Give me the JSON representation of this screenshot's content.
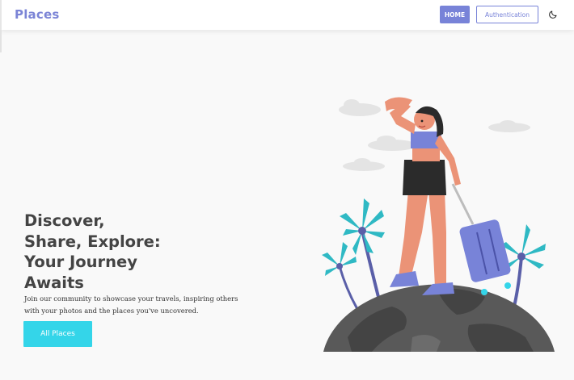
{
  "app": {
    "brand": "Places"
  },
  "nav": {
    "home_label": "HOME",
    "auth_label": "Authentication",
    "theme_icon": "moon-icon"
  },
  "hero": {
    "headline": "Discover,\nShare, Explore:\nYour Journey\nAwaits",
    "subtext": "Join our community to showcase your travels, inspiring others with your photos and the places you've uncovered.",
    "cta_label": "All Places"
  },
  "colors": {
    "brand": "#7b84d6",
    "accent": "#7883d8",
    "cta": "#34d5e9",
    "headline": "#444444"
  },
  "illustration": {
    "subject": "traveler-on-globe-illustration"
  }
}
